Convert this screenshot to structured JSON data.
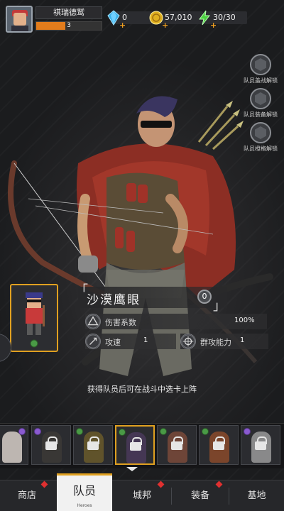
{
  "player": {
    "name": "祺瑞德鹫",
    "level": "3",
    "exp_fraction": 0.45
  },
  "resources": [
    {
      "name": "gems",
      "icon": "diamond-icon",
      "value": "0",
      "plus": "+"
    },
    {
      "name": "coins",
      "icon": "coin-icon",
      "value": "57,010",
      "plus": "+"
    },
    {
      "name": "energy",
      "icon": "lightning-icon",
      "value": "30/30",
      "plus": "+"
    }
  ],
  "unlocks": [
    {
      "label": "队员盖战解锁"
    },
    {
      "label": "队员装备解锁"
    },
    {
      "label": "队员橙格解锁"
    }
  ],
  "hero": {
    "name": "沙漠鹰眼",
    "level": "0",
    "stats": {
      "damage_label": "伤害系数",
      "damage_value": "100%",
      "speed_label": "攻速",
      "speed_value": "1",
      "aoe_label": "群攻能力",
      "aoe_value": "1"
    },
    "hint": "获得队员后可在战斗中选卡上阵"
  },
  "roster": {
    "slots": [
      {
        "name": "roster-slot-1",
        "locked": false,
        "tag": "purple"
      },
      {
        "name": "roster-slot-2",
        "locked": true,
        "tag": "purple"
      },
      {
        "name": "roster-slot-3",
        "locked": true,
        "tag": "green"
      },
      {
        "name": "roster-slot-4",
        "locked": true,
        "tag": "green",
        "selected": true
      },
      {
        "name": "roster-slot-5",
        "locked": true,
        "tag": "green"
      },
      {
        "name": "roster-slot-6",
        "locked": true,
        "tag": "green"
      },
      {
        "name": "roster-slot-7",
        "locked": true,
        "tag": "purple"
      }
    ]
  },
  "nav": {
    "shop": "商店",
    "team": "队员",
    "team_sub": "Heroes",
    "city": "城邦",
    "gear": "装备",
    "base": "基地"
  },
  "colors": {
    "accent": "#e0a020",
    "exp": "#e27c1c",
    "badge": "#e03030"
  }
}
